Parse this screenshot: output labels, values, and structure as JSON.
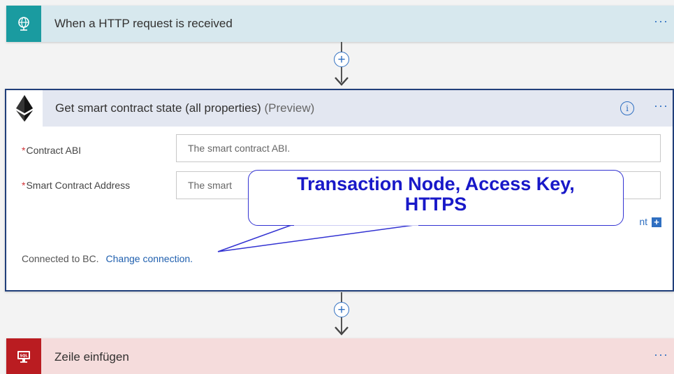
{
  "trigger": {
    "title": "When a HTTP request is received",
    "icon": "globe-request-icon",
    "color": "#1a9ba0",
    "more_label": "···"
  },
  "action": {
    "icon": "ethereum-icon",
    "title": "Get smart contract state (all properties)",
    "preview": "(Preview)",
    "info_label": "i",
    "more_label": "···",
    "fields": {
      "contract_abi": {
        "required_mark": "*",
        "label": "Contract ABI",
        "placeholder": "The smart contract ABI."
      },
      "smart_contract_address": {
        "required_mark": "*",
        "label": "Smart Contract Address",
        "placeholder": "The smart"
      }
    },
    "add_param_label": "nt",
    "add_param_icon": "+",
    "connection_text": "Connected to BC.",
    "change_connection_label": "Change connection."
  },
  "connectors": {
    "plus_label": "+"
  },
  "sql_step": {
    "title": "Zeile einfügen",
    "icon": "sql-server-icon",
    "color": "#ba1c21",
    "more_label": "···"
  },
  "callout": {
    "line1": "Transaction Node, Access Key,",
    "line2": "HTTPS"
  }
}
